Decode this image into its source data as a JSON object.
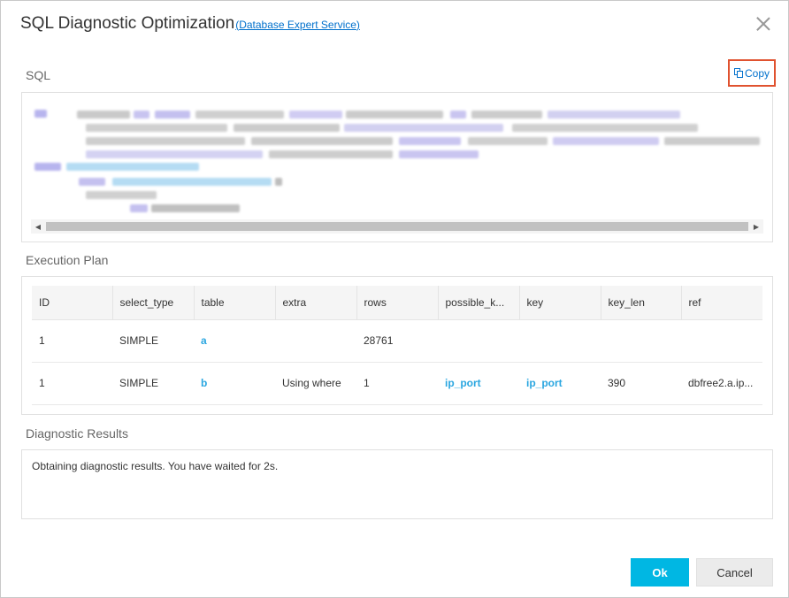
{
  "dialog": {
    "title": "SQL Diagnostic Optimization",
    "title_link": "Database Expert Service",
    "title_link_open": "(",
    "title_link_close": ")"
  },
  "sql_section": {
    "label": "SQL",
    "copy_label": "Copy"
  },
  "plan_section": {
    "label": "Execution Plan",
    "columns": [
      "ID",
      "select_type",
      "table",
      "extra",
      "rows",
      "possible_k...",
      "key",
      "key_len",
      "ref"
    ],
    "rows": [
      [
        "1",
        "SIMPLE",
        "a",
        "",
        "28761",
        "",
        "",
        "",
        ""
      ],
      [
        "1",
        "SIMPLE",
        "b",
        "Using where",
        "1",
        "ip_port",
        "ip_port",
        "390",
        "dbfree2.a.ip..."
      ]
    ]
  },
  "results_section": {
    "label": "Diagnostic Results",
    "text": "Obtaining diagnostic results. You have waited for 2s."
  },
  "buttons": {
    "ok": "Ok",
    "cancel": "Cancel"
  },
  "colors": {
    "accent": "#00b7e3",
    "link": "#0070cc",
    "table_link": "#2aa6e0",
    "highlight_border": "#e0522f"
  }
}
